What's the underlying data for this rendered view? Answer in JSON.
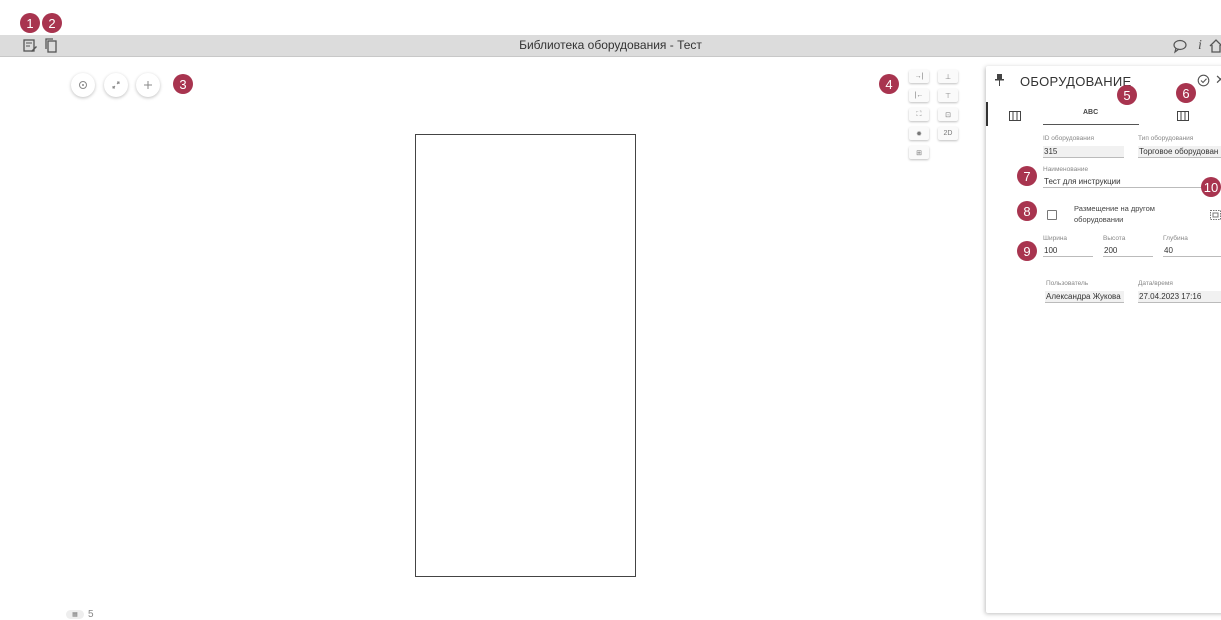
{
  "badges": [
    "1",
    "2",
    "3",
    "4",
    "5",
    "6",
    "7",
    "8",
    "9",
    "10"
  ],
  "topbar": {
    "title": "Библиотека оборудования - Тест",
    "left_icons": [
      "edit-note-icon",
      "copy-icon"
    ],
    "right_icons": [
      "chat-icon",
      "info-icon",
      "home-icon"
    ],
    "info_glyph": "i"
  },
  "tools_left": [
    "target-icon",
    "expand-icon",
    "move-icon"
  ],
  "tools_right": {
    "twoD_label": "2D"
  },
  "bottom": {
    "count": "5"
  },
  "panel": {
    "title": "ОБОРУДОВАНИЕ",
    "tab_abc": "ABC",
    "fields": {
      "id_label": "ID оборудования",
      "id_value": "315",
      "type_label": "Тип оборудования",
      "type_value": "Торговое оборудован",
      "name_label": "Наименование",
      "name_value": "Тест для инструкции",
      "placement_label_1": "Размещение на другом",
      "placement_label_2": "оборудовании",
      "width_label": "Ширина",
      "width_value": "100",
      "height_label": "Высота",
      "height_value": "200",
      "depth_label": "Глубина",
      "depth_value": "40",
      "user_label": "Пользователь",
      "user_value": "Александра Жукова",
      "datetime_label": "Дата/время",
      "datetime_value": "27.04.2023 17:16"
    }
  },
  "colors": {
    "badge": "#a8344f",
    "topbar": "#dcdcdc"
  }
}
